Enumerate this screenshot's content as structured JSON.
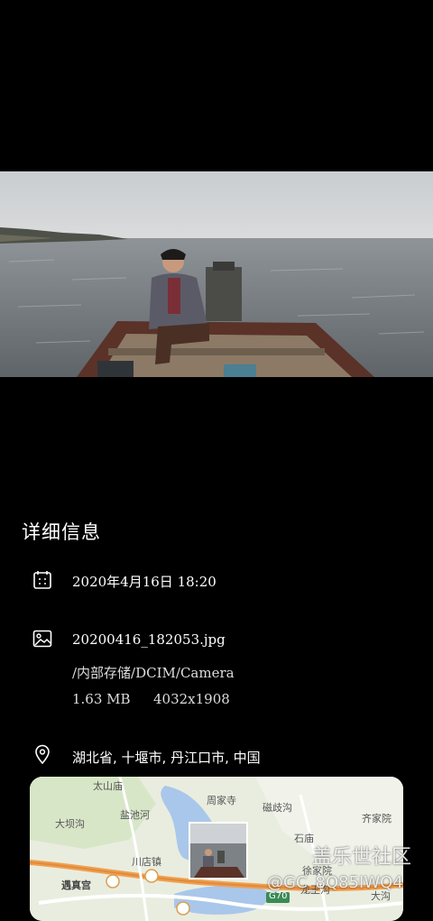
{
  "details": {
    "title": "详细信息",
    "datetime": "2020年4月16日  18:20",
    "filename": "20200416_182053.jpg",
    "path": "/内部存储/DCIM/Camera",
    "size": "1.63 MB",
    "resolution": "4032x1908",
    "location": "湖北省, 十堰市, 丹江口市, 中国"
  },
  "map": {
    "labels": [
      "太山庙",
      "周家寺",
      "磁歧沟",
      "齐家院",
      "大坝沟",
      "盐池河",
      "石庙",
      "川店镇",
      "遇真宫",
      "徐家院",
      "龙王沟",
      "大沟",
      "G70"
    ]
  },
  "watermark": {
    "brand": "盖乐世社区",
    "user": "@GC_8Q85IWQ4"
  },
  "icons": {
    "date": "calendar-icon",
    "file": "image-icon",
    "location": "location-pin-icon"
  }
}
